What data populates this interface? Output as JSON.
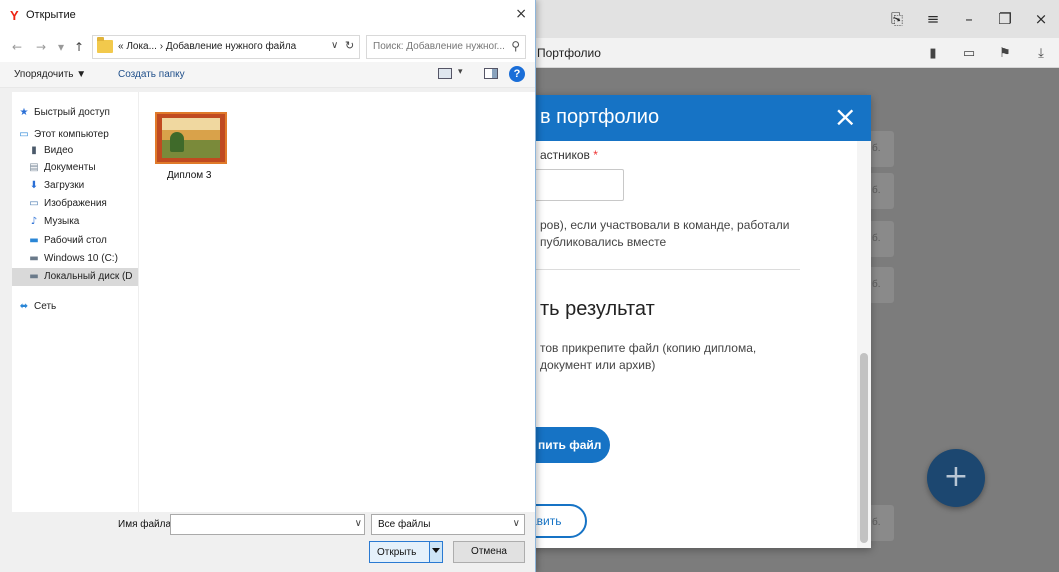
{
  "browser": {
    "tab_title": "Портфолио",
    "titlebar_icons": [
      "bookmark-screen-icon",
      "menu-icon",
      "minimize-icon",
      "restore-icon",
      "close-icon"
    ],
    "toolbar_icons": [
      "bookmark-icon",
      "battery-icon",
      "translate-icon",
      "download-icon"
    ]
  },
  "background": {
    "card_labels": [
      "б.",
      "б.",
      "б.",
      "б.",
      "б."
    ],
    "fab_label": "+"
  },
  "modal": {
    "title": "в портфолио",
    "participants_label": "астников",
    "required_mark": "*",
    "team_hint_line1": "ров), если участвовали в команде, работали",
    "team_hint_line2": "публиковались вместе",
    "result_heading": "ть результат",
    "attach_hint_line1": "тов прикрепите файл (копию диплома,",
    "attach_hint_line2": "документ или архив)",
    "attach_button": "пить файл",
    "add_button": "авить",
    "close_icon": "×",
    "accent_color": "#1673c5"
  },
  "dialog": {
    "title": "Открытие",
    "app_icon": "Y",
    "close": "×",
    "nav": {
      "back": "←",
      "forward": "→",
      "recent": "▾",
      "up": "↑",
      "path": "« Лока... › Добавление нужного файла",
      "path_dropdown": "∨",
      "refresh": "↻",
      "search_placeholder": "Поиск: Добавление нужног...",
      "search_icon": "⚲"
    },
    "toolbar": {
      "organize": "Упорядочить ▼",
      "new_folder": "Создать папку",
      "view_arrow": "▾",
      "help": "?"
    },
    "nav_pane": [
      {
        "label": "Быстрый доступ",
        "icon": "★",
        "icon_name": "quick-access-icon",
        "color": "#2a6fd6",
        "level": 0,
        "selected": false
      },
      {
        "label": "Этот компьютер",
        "icon": "▭",
        "icon_name": "computer-icon",
        "color": "#2a86d6",
        "level": 0,
        "selected": false
      },
      {
        "label": "Видео",
        "icon": "▮",
        "icon_name": "video-folder-icon",
        "color": "#4b5a6a",
        "level": 1,
        "selected": false
      },
      {
        "label": "Документы",
        "icon": "▤",
        "icon_name": "documents-folder-icon",
        "color": "#7a8a9a",
        "level": 1,
        "selected": false
      },
      {
        "label": "Загрузки",
        "icon": "⬇",
        "icon_name": "downloads-folder-icon",
        "color": "#2a6fd6",
        "level": 1,
        "selected": false
      },
      {
        "label": "Изображения",
        "icon": "▭",
        "icon_name": "pictures-folder-icon",
        "color": "#4a7ab0",
        "level": 1,
        "selected": false
      },
      {
        "label": "Музыка",
        "icon": "♪",
        "icon_name": "music-folder-icon",
        "color": "#2a6fd6",
        "level": 1,
        "selected": false
      },
      {
        "label": "Рабочий стол",
        "icon": "▬",
        "icon_name": "desktop-folder-icon",
        "color": "#2a86d6",
        "level": 1,
        "selected": false
      },
      {
        "label": "Windows 10 (C:)",
        "icon": "▬",
        "icon_name": "drive-c-icon",
        "color": "#6a7a8a",
        "level": 1,
        "selected": false
      },
      {
        "label": "Локальный диск (D",
        "icon": "▬",
        "icon_name": "drive-d-icon",
        "color": "#6a7a8a",
        "level": 1,
        "selected": true
      },
      {
        "label": "Сеть",
        "icon": "⬌",
        "icon_name": "network-icon",
        "color": "#2a86d6",
        "level": 0,
        "selected": false
      }
    ],
    "files": [
      {
        "name": "Диплом 3"
      }
    ],
    "bottom": {
      "filename_label": "Имя файла:",
      "filename_value": "",
      "filename_dropdown": "∨",
      "filetype": "Все файлы",
      "filetype_dropdown": "∨",
      "open": "Открыть",
      "cancel": "Отмена"
    }
  }
}
